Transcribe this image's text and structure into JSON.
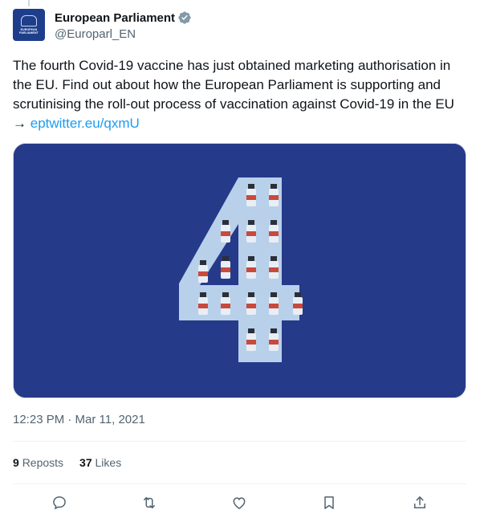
{
  "author": {
    "display_name": "European Parliament",
    "handle": "@Europarl_EN",
    "avatar_text": "EUROPEAN PARLIAMENT",
    "verified_icon": "verified-badge-icon",
    "avatar_icon": "parliament-logo-icon"
  },
  "tweet": {
    "text": "The fourth Covid-19 vaccine has just obtained marketing authorisation in the EU. Find out about how the European Parliament is supporting and scrutinising the roll-out process of vaccination against Covid-19 in the EU → ",
    "link_text": "eptwitter.eu/qxmU"
  },
  "media": {
    "description_icon": "number-four-vaccine-vials-image",
    "background_color": "#263a8a",
    "digit_color": "#b8d0ea"
  },
  "timestamp": "12:23 PM · Mar 11, 2021",
  "stats": {
    "reposts_count": "9",
    "reposts_label": "Reposts",
    "likes_count": "37",
    "likes_label": "Likes"
  },
  "actions": [
    {
      "name": "reply-icon"
    },
    {
      "name": "repost-icon"
    },
    {
      "name": "like-icon"
    },
    {
      "name": "bookmark-icon"
    },
    {
      "name": "share-icon"
    }
  ],
  "colors": {
    "link": "#1d9bf0",
    "secondary_text": "#536471",
    "primary_text": "#0f1419"
  }
}
